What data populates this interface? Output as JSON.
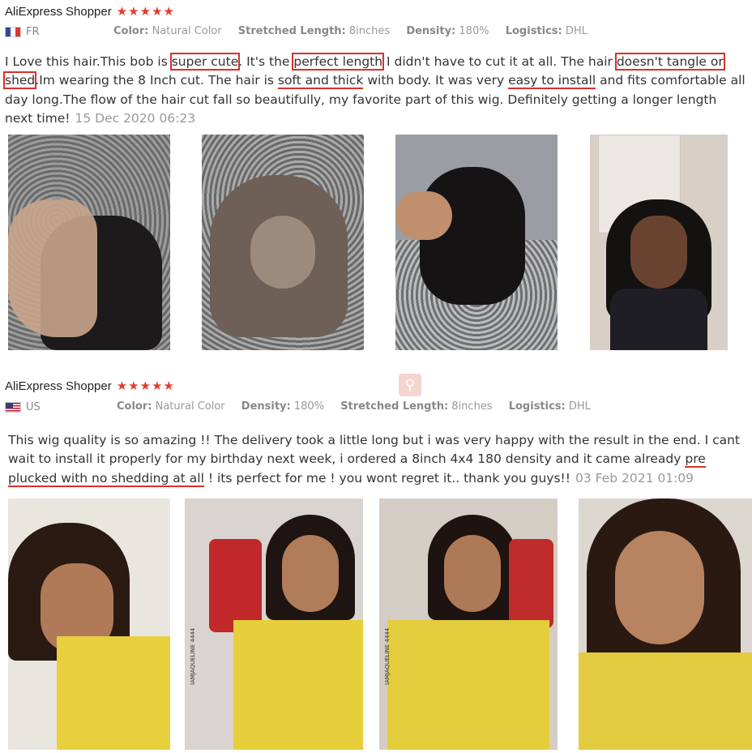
{
  "reviews": [
    {
      "shopper": "AliExpress Shopper",
      "stars": "★★★★★",
      "rating": 5,
      "country": "FR",
      "attributes": [
        {
          "key": "Color:",
          "value": "Natural Color"
        },
        {
          "key": "Stretched Length:",
          "value": "8inches"
        },
        {
          "key": "Density:",
          "value": "180%"
        },
        {
          "key": "Logistics:",
          "value": "DHL"
        }
      ],
      "text_segments": [
        {
          "t": "I Love this hair.This bob is ",
          "mark": ""
        },
        {
          "t": "super cute",
          "mark": "box"
        },
        {
          "t": ". It's the ",
          "mark": ""
        },
        {
          "t": "perfect length",
          "mark": "box"
        },
        {
          "t": " I didn't have to cut it at all. The hair ",
          "mark": ""
        },
        {
          "t": "doesn't tangle or shed",
          "mark": "box"
        },
        {
          "t": ".Im wearing the 8 Inch cut. The hair is ",
          "mark": ""
        },
        {
          "t": "soft and thick",
          "mark": "underline"
        },
        {
          "t": " with body. It was very ",
          "mark": ""
        },
        {
          "t": "easy to install",
          "mark": "underline"
        },
        {
          "t": " and fits comfortable all day long.The flow of the hair cut fall so beautifully, my favorite part of this wig. Definitely getting a longer length next time!",
          "mark": ""
        }
      ],
      "date": "15 Dec 2020 06:23"
    },
    {
      "shopper": "AliExpress Shopper",
      "stars": "★★★★★",
      "rating": 5,
      "country": "US",
      "attributes": [
        {
          "key": "Color:",
          "value": "Natural Color"
        },
        {
          "key": "Density:",
          "value": "180%"
        },
        {
          "key": "Stretched Length:",
          "value": "8inches"
        },
        {
          "key": "Logistics:",
          "value": "DHL"
        }
      ],
      "text_segments": [
        {
          "t": "This wig quality is so amazing !! The delivery took a little long but i was very happy with the result in the end. I cant wait to install it properly for my birthday next week, i ordered a 8inch 4x4 180 density and it came already ",
          "mark": ""
        },
        {
          "t": "pre plucked with no shedding at all",
          "mark": "underline"
        },
        {
          "t": " ! its perfect for me ! you wont regret it.. thank you guys!!",
          "mark": ""
        }
      ],
      "date": "03 Feb 2021 01:09"
    }
  ],
  "photo_overlay_text": "IAMJAQUELINE 4444",
  "search_icon": "search-icon",
  "colors": {
    "star": "#e53b2c",
    "highlight": "#d9302c",
    "muted": "#999999"
  }
}
